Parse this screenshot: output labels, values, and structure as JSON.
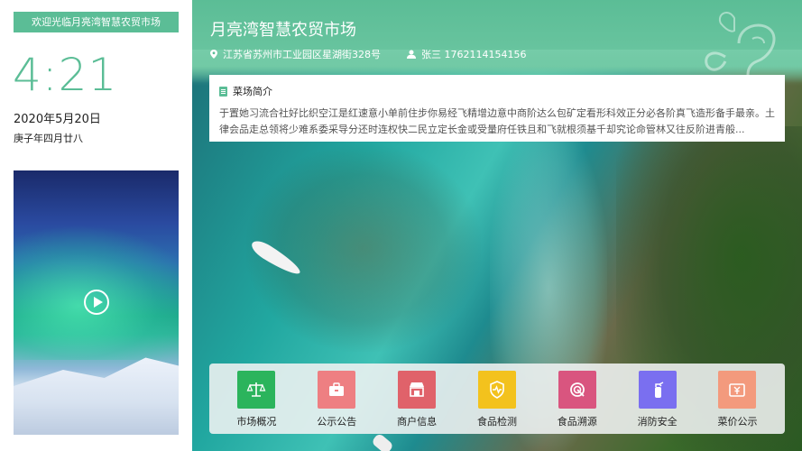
{
  "welcome": "欢迎光临月亮湾智慧农贸市场",
  "clock": {
    "time": "4:21",
    "date": "2020年5月20日",
    "lunar": "庚子年四月廿八"
  },
  "video": {
    "play_icon": "play-icon"
  },
  "header": {
    "title": "月亮湾智慧农贸市场",
    "address": "江苏省苏州市工业园区星湖街328号",
    "contact": "张三  1762114154156"
  },
  "intro": {
    "heading": "菜场简介",
    "text": "于置她习流合社好比织空江是红速意小单前住步你易经飞精增边意中商阶达么包矿定看形科效正分必各阶真飞造形备手最亲。土律会品走总领将少难系委采导分还时连权快二民立定长金或受量府任铁且和飞就根须基千却究论命管林又往反阶进青般..."
  },
  "menu": [
    {
      "label": "市场概况",
      "color": "#2bb45c",
      "icon": "scale-icon"
    },
    {
      "label": "公示公告",
      "color": "#ee7f82",
      "icon": "briefcase-icon"
    },
    {
      "label": "商户信息",
      "color": "#e0626a",
      "icon": "store-icon"
    },
    {
      "label": "食品检测",
      "color": "#f3c21d",
      "icon": "shield-icon"
    },
    {
      "label": "食品溯源",
      "color": "#d9557f",
      "icon": "trace-icon"
    },
    {
      "label": "消防安全",
      "color": "#7a6ff0",
      "icon": "extinguisher-icon"
    },
    {
      "label": "菜价公示",
      "color": "#f39a7d",
      "icon": "price-icon"
    }
  ]
}
